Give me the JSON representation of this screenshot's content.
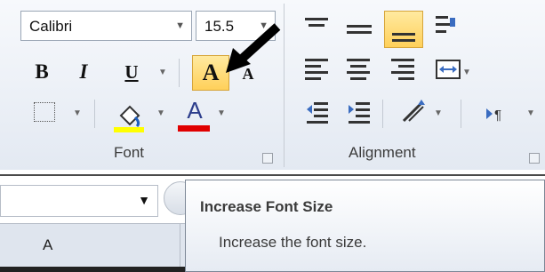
{
  "font_group": {
    "font_name": "Calibri",
    "font_size": "15.5",
    "bold_glyph": "B",
    "italic_glyph": "I",
    "underline_glyph": "U",
    "grow_glyph": "A",
    "shrink_glyph": "A",
    "font_color_glyph": "A",
    "label": "Font",
    "highlight_color": "#ffff00",
    "font_color": "#e00000"
  },
  "alignment_group": {
    "label": "Alignment",
    "active_button": "bottom-align"
  },
  "name_box": {
    "value": ""
  },
  "column_header": "A",
  "tooltip": {
    "title": "Increase Font Size",
    "description": "Increase the font size."
  }
}
